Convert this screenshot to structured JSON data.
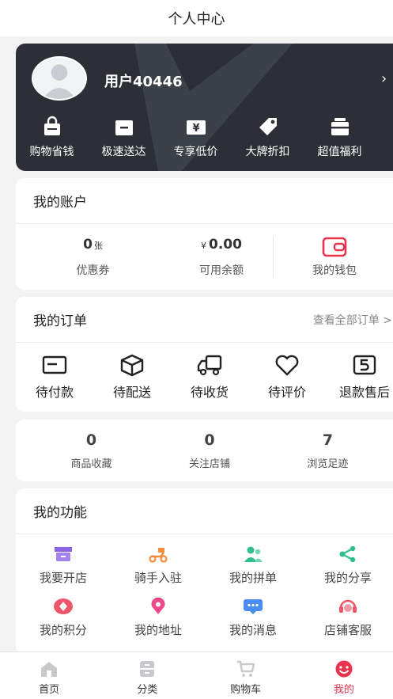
{
  "header": {
    "title": "个人中心"
  },
  "member_card": {
    "username": "用户40446",
    "perks": [
      {
        "icon": "bag-icon",
        "label": "购物省钱"
      },
      {
        "icon": "package-icon",
        "label": "极速送达"
      },
      {
        "icon": "yen-ticket-icon",
        "label": "专享低价"
      },
      {
        "icon": "tag-icon",
        "label": "大牌折扣"
      },
      {
        "icon": "gift-icon",
        "label": "超值福利"
      }
    ]
  },
  "account": {
    "title": "我的账户",
    "coupon_count": "0",
    "coupon_unit": "张",
    "coupon_label": "优惠券",
    "currency": "¥",
    "balance": "0.00",
    "balance_label": "可用余额",
    "wallet_label": "我的钱包"
  },
  "orders": {
    "title": "我的订单",
    "view_all": "查看全部订单 >",
    "items": [
      {
        "icon": "card-icon",
        "label": "待付款"
      },
      {
        "icon": "box-icon",
        "label": "待配送"
      },
      {
        "icon": "truck-icon",
        "label": "待收货"
      },
      {
        "icon": "heart-icon",
        "label": "待评价"
      },
      {
        "icon": "refund-icon",
        "label": "退款售后"
      }
    ]
  },
  "stats": [
    {
      "value": "0",
      "label": "商品收藏"
    },
    {
      "value": "0",
      "label": "关注店铺"
    },
    {
      "value": "7",
      "label": "浏览足迹"
    }
  ],
  "features": {
    "title": "我的功能",
    "items": [
      {
        "icon": "shop-icon",
        "label": "我要开店",
        "color": "#8b63e8"
      },
      {
        "icon": "scooter-icon",
        "label": "骑手入驻",
        "color": "#f28b3a"
      },
      {
        "icon": "group-icon",
        "label": "我的拼单",
        "color": "#2fbf8f"
      },
      {
        "icon": "share-icon",
        "label": "我的分享",
        "color": "#2fbf8f"
      },
      {
        "icon": "points-icon",
        "label": "我的积分",
        "color": "#f0566a"
      },
      {
        "icon": "location-icon",
        "label": "我的地址",
        "color": "#ee4a8a"
      },
      {
        "icon": "message-icon",
        "label": "我的消息",
        "color": "#4a8cf0"
      },
      {
        "icon": "headset-icon",
        "label": "店铺客服",
        "color": "#f0566a"
      }
    ]
  },
  "tabbar": {
    "items": [
      {
        "icon": "home-icon",
        "label": "首页"
      },
      {
        "icon": "category-icon",
        "label": "分类"
      },
      {
        "icon": "cart-icon",
        "label": "购物车"
      },
      {
        "icon": "profile-icon",
        "label": "我的"
      }
    ],
    "active_color": "#e8344e"
  }
}
